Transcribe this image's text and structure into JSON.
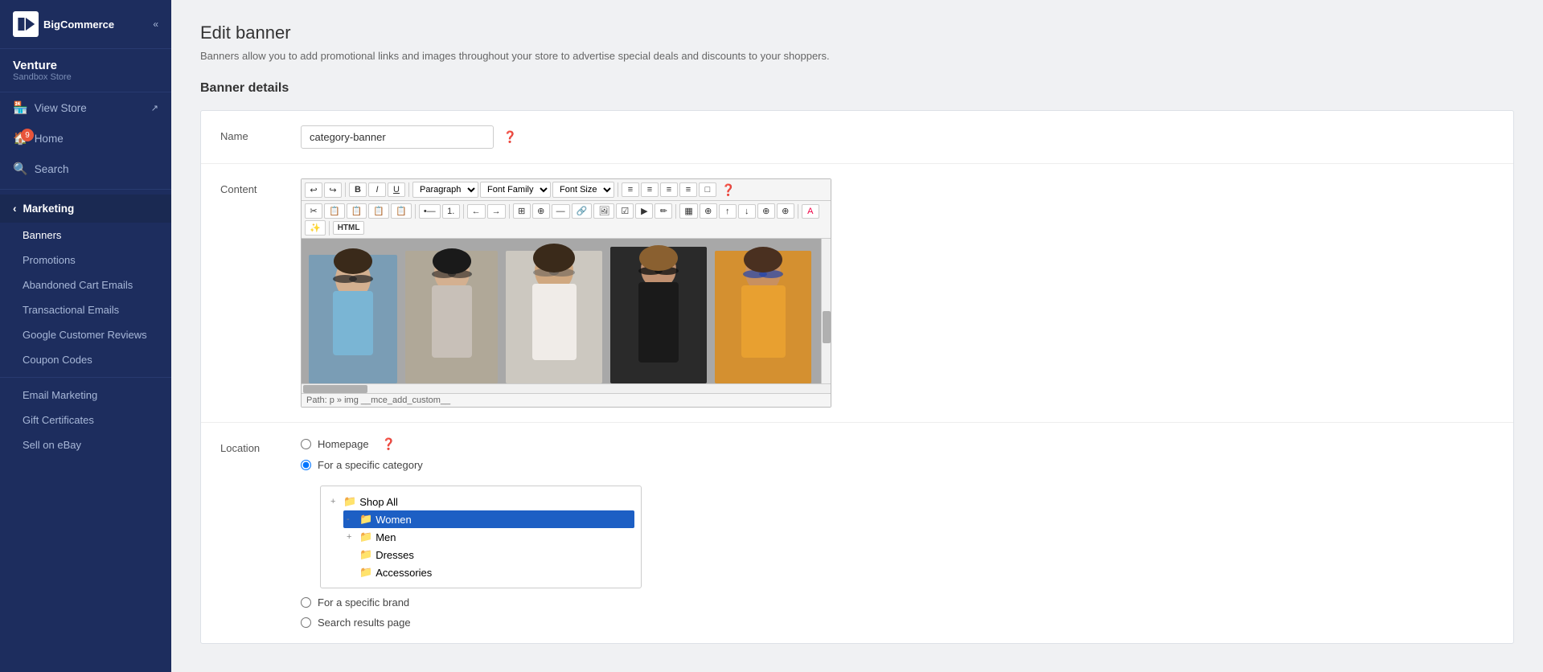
{
  "sidebar": {
    "logo_alt": "BigCommerce",
    "store_name": "Venture",
    "store_sub": "Sandbox Store",
    "collapse_icon": "«",
    "nav": [
      {
        "id": "view-store",
        "label": "View Store",
        "icon": "🏠",
        "has_badge": false,
        "ext": true
      },
      {
        "id": "home",
        "label": "Home",
        "icon": "🏠",
        "has_badge": true,
        "badge_count": "9"
      },
      {
        "id": "search",
        "label": "Search",
        "icon": "🔍",
        "has_badge": false
      }
    ],
    "marketing_section": "Marketing",
    "sub_items": [
      {
        "id": "banners",
        "label": "Banners",
        "active": true
      },
      {
        "id": "promotions",
        "label": "Promotions"
      },
      {
        "id": "abandoned-cart",
        "label": "Abandoned Cart Emails"
      },
      {
        "id": "transactional",
        "label": "Transactional Emails"
      },
      {
        "id": "google-reviews",
        "label": "Google Customer Reviews"
      },
      {
        "id": "coupon-codes",
        "label": "Coupon Codes"
      }
    ],
    "extra_items": [
      {
        "id": "email-marketing",
        "label": "Email Marketing"
      },
      {
        "id": "gift-certificates",
        "label": "Gift Certificates"
      },
      {
        "id": "sell-on-ebay",
        "label": "Sell on eBay"
      }
    ]
  },
  "main": {
    "page_title": "Edit banner",
    "page_subtitle": "Banners allow you to add promotional links and images throughout your store to advertise special deals and discounts to your shoppers.",
    "section_title": "Banner details",
    "form": {
      "name_label": "Name",
      "name_value": "category-banner",
      "name_placeholder": "category-banner",
      "content_label": "Content",
      "location_label": "Location",
      "rte": {
        "toolbar_row1": [
          "↩",
          "↪",
          "—",
          "B",
          "I",
          "U",
          "—",
          "Paragraph",
          "Font Family",
          "Font Size",
          "—",
          "≡",
          "≡",
          "≡",
          "≡",
          "□"
        ],
        "toolbar_row2": [
          "✂",
          "📋",
          "📋",
          "📋",
          "📋",
          "—",
          "•",
          "1.",
          "—",
          "←",
          "→",
          "—",
          "⊞",
          "⊕",
          "↔",
          "🔗",
          "🖼",
          "☑",
          "❌",
          "✏",
          "—",
          "▦",
          "⊕",
          "←",
          "→",
          "↑",
          "↓",
          "⊕",
          "⊕",
          "—",
          "▦",
          "⊕",
          "A",
          "✨",
          "—",
          "HTML"
        ],
        "statusbar": "Path: p » img __mce_add_custom__"
      },
      "location": {
        "options": [
          {
            "id": "homepage",
            "label": "Homepage",
            "checked": false
          },
          {
            "id": "specific-category",
            "label": "For a specific category",
            "checked": true
          },
          {
            "id": "specific-brand",
            "label": "For a specific brand",
            "checked": false
          },
          {
            "id": "search-results",
            "label": "Search results page",
            "checked": false
          }
        ],
        "tree": [
          {
            "id": "shop-all",
            "label": "Shop All",
            "indent": 0,
            "expanded": true,
            "selected": false
          },
          {
            "id": "women",
            "label": "Women",
            "indent": 1,
            "expanded": false,
            "selected": true
          },
          {
            "id": "men",
            "label": "Men",
            "indent": 1,
            "expanded": true,
            "selected": false
          },
          {
            "id": "dresses",
            "label": "Dresses",
            "indent": 2,
            "selected": false
          },
          {
            "id": "accessories",
            "label": "Accessories",
            "indent": 2,
            "selected": false
          }
        ]
      }
    }
  }
}
